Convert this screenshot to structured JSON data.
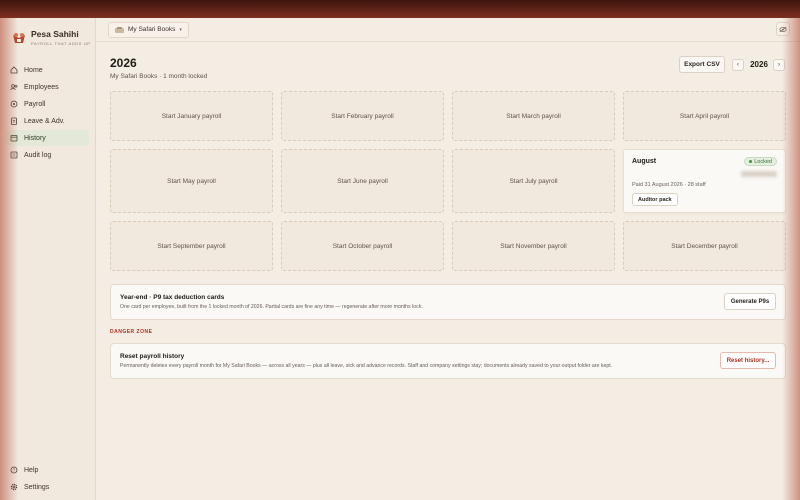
{
  "brand": {
    "name": "Pesa Sahihi",
    "tagline": "PAYROLL THAT ADDS UP"
  },
  "nav": {
    "items": [
      {
        "label": "Home",
        "icon": "home-icon"
      },
      {
        "label": "Employees",
        "icon": "users-icon"
      },
      {
        "label": "Payroll",
        "icon": "payroll-icon"
      },
      {
        "label": "Leave & Adv.",
        "icon": "clipboard-icon"
      },
      {
        "label": "History",
        "icon": "calendar-icon",
        "active": true
      },
      {
        "label": "Audit log",
        "icon": "list-icon"
      }
    ],
    "bottom": [
      {
        "label": "Help",
        "icon": "help-icon"
      },
      {
        "label": "Settings",
        "icon": "gear-icon"
      }
    ]
  },
  "topbar": {
    "company": "My Safari Books"
  },
  "page": {
    "title": "2026",
    "subtitle": "My Safari Books · 1 month locked",
    "export_label": "Export CSV",
    "year": "2026"
  },
  "months": [
    {
      "label": "Start January payroll"
    },
    {
      "label": "Start February payroll"
    },
    {
      "label": "Start March payroll"
    },
    {
      "label": "Start April payroll"
    },
    {
      "label": "Start May payroll"
    },
    {
      "label": "Start June payroll"
    },
    {
      "label": "Start July payroll"
    },
    {
      "label": "August",
      "locked": true,
      "badge": "Locked",
      "meta": "Paid 31 August 2026 · 28 staff",
      "action": "Auditor pack"
    },
    {
      "label": "Start September payroll"
    },
    {
      "label": "Start October payroll"
    },
    {
      "label": "Start November payroll"
    },
    {
      "label": "Start December payroll"
    }
  ],
  "p9": {
    "title": "Year-end · P9 tax deduction cards",
    "desc": "One card per employee, built from the 1 locked month of 2026. Partial cards are fine any time — regenerate after more months lock.",
    "button": "Generate P9s"
  },
  "danger": {
    "label": "DANGER ZONE",
    "title": "Reset payroll history",
    "desc": "Permanently deletes every payroll month for My Safari Books — across all years — plus all leave, sick and advance records. Staff and company settings stay; documents already saved to your output folder are kept.",
    "button": "Reset history..."
  },
  "colors": {
    "accent": "#a8321f",
    "active_nav": "#e3e8d8",
    "locked_badge": "#4d8a46"
  }
}
